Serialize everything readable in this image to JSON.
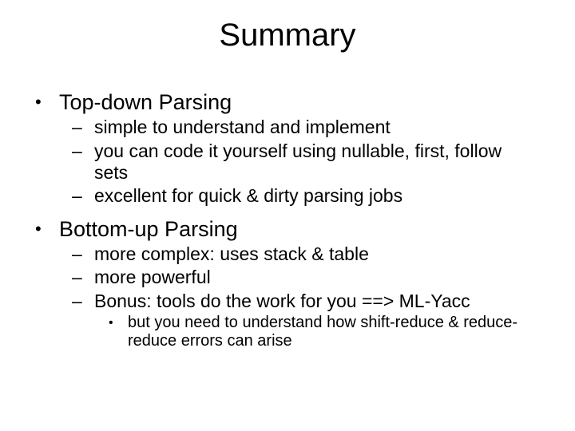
{
  "title": "Summary",
  "section1": {
    "heading": "Top-down Parsing",
    "items": [
      "simple to understand and implement",
      "you can code it yourself using nullable, first, follow sets",
      "excellent for quick & dirty parsing jobs"
    ]
  },
  "section2": {
    "heading": "Bottom-up Parsing",
    "items": [
      "more complex: uses stack & table",
      "more powerful",
      "Bonus: tools do the work for you ==> ML-Yacc"
    ],
    "subitems": [
      "but you need to understand how shift-reduce & reduce-reduce errors can arise"
    ]
  }
}
